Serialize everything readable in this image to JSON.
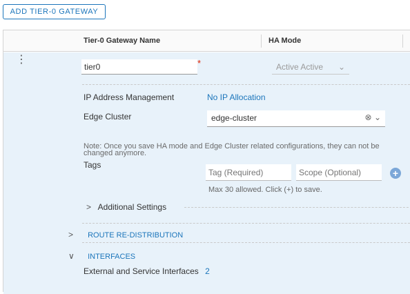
{
  "toolbar": {
    "add_gateway_label": "ADD TIER-0 GATEWAY"
  },
  "table": {
    "columns": [
      "Tier-0 Gateway Name",
      "HA Mode"
    ],
    "row": {
      "actions_glyph": "⋮",
      "name_value": "tier0",
      "required_mark": "*",
      "ha_mode_value": "Active Active",
      "ha_mode_chevron": "⌄"
    }
  },
  "details": {
    "ip_label": "IP Address Management",
    "ip_value": "No IP Allocation",
    "edge_label": "Edge Cluster",
    "edge_value": "edge-cluster",
    "edge_clear_icon": "⊗",
    "edge_chevron": "⌄",
    "note": "Note: Once you save HA mode and Edge Cluster related configurations, they can not be changed anymore.",
    "tags_label": "Tags",
    "tag_placeholder": "Tag (Required)",
    "scope_placeholder": "Scope (Optional)",
    "tag_add_glyph": "+",
    "tags_hint": "Max 30 allowed. Click (+) to save.",
    "additional_settings": "Additional Settings",
    "additional_chevron": ">"
  },
  "sections": {
    "route_redistribution": {
      "label": "ROUTE RE-DISTRIBUTION",
      "chevron": ">"
    },
    "interfaces": {
      "label": "INTERFACES",
      "chevron": "∨"
    }
  },
  "interfaces": {
    "external_label": "External and Service Interfaces",
    "external_count": "2"
  }
}
